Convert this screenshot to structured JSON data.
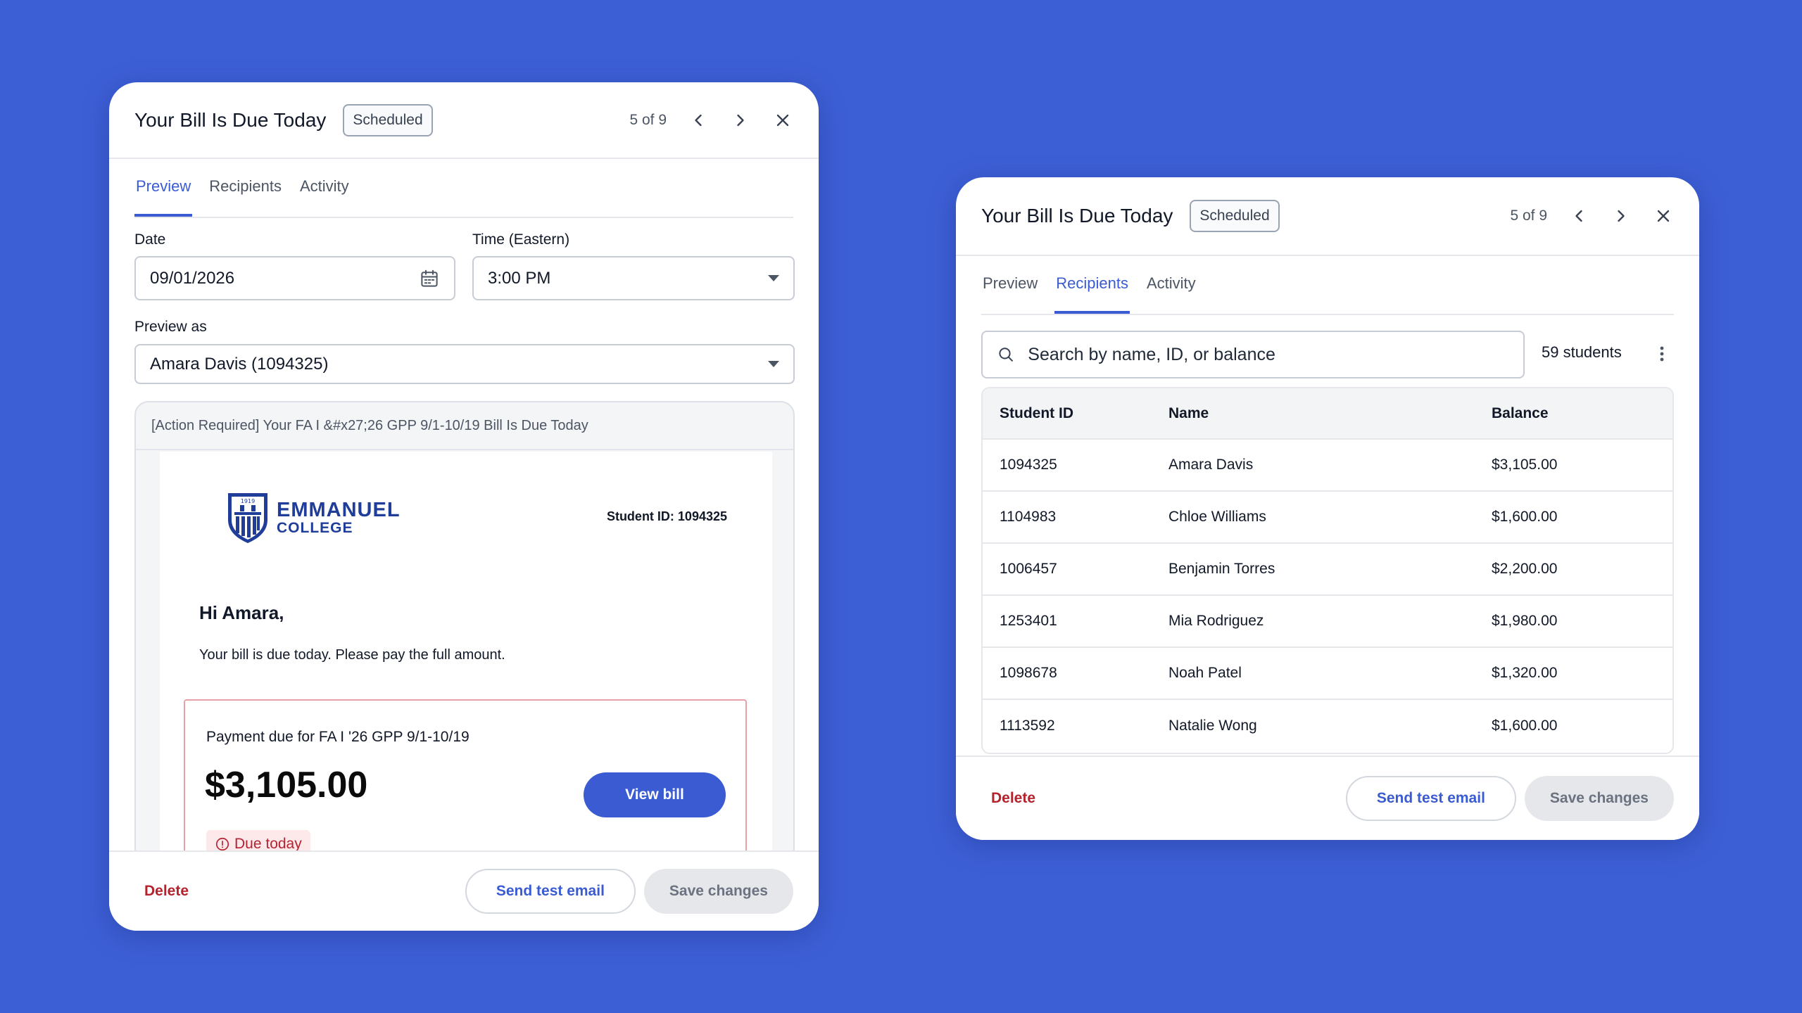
{
  "left_modal": {
    "title": "Your Bill Is Due Today",
    "status_badge": "Scheduled",
    "pager": "5 of 9",
    "tabs": [
      {
        "label": "Preview",
        "active": true
      },
      {
        "label": "Recipients",
        "active": false
      },
      {
        "label": "Activity",
        "active": false
      }
    ],
    "date_label": "Date",
    "date_value": "09/01/2026",
    "time_label": "Time (Eastern)",
    "time_value": "3:00 PM",
    "preview_as_label": "Preview as",
    "preview_as_value": "Amara Davis (1094325)",
    "email": {
      "subject": "[Action Required] Your FA I &#x27;26 GPP 9/1-10/19 Bill Is Due Today",
      "logo_line1": "EMMANUEL",
      "logo_line2": "COLLEGE",
      "logo_year": "1919",
      "student_id_line": "Student ID: 1094325",
      "greeting": "Hi Amara,",
      "message": "Your bill is due today. Please pay the full amount.",
      "payment_label": "Payment due for FA I '26 GPP 9/1-10/19",
      "amount": "$3,105.00",
      "view_bill_label": "View bill",
      "due_chip": "Due today"
    },
    "footer": {
      "delete_label": "Delete",
      "send_test_label": "Send test email",
      "save_label": "Save changes"
    }
  },
  "right_modal": {
    "title": "Your Bill Is Due Today",
    "status_badge": "Scheduled",
    "pager": "5 of 9",
    "tabs": [
      {
        "label": "Preview",
        "active": false
      },
      {
        "label": "Recipients",
        "active": true
      },
      {
        "label": "Activity",
        "active": false
      }
    ],
    "search_placeholder": "Search by name, ID, or balance",
    "count": "59 students",
    "columns": [
      "Student ID",
      "Name",
      "Balance"
    ],
    "rows": [
      [
        "1094325",
        "Amara Davis",
        "$3,105.00"
      ],
      [
        "1104983",
        "Chloe Williams",
        "$1,600.00"
      ],
      [
        "1006457",
        "Benjamin Torres",
        "$2,200.00"
      ],
      [
        "1253401",
        "Mia Rodriguez",
        "$1,980.00"
      ],
      [
        "1098678",
        "Noah Patel",
        "$1,320.00"
      ],
      [
        "1113592",
        "Natalie Wong",
        "$1,600.00"
      ]
    ],
    "footer": {
      "delete_label": "Delete",
      "send_test_label": "Send test email",
      "save_label": "Save changes"
    }
  },
  "colors": {
    "background": "#3d5fd6",
    "accent": "#3a5bd2",
    "danger": "#b4232d",
    "brand": "#1f3d99"
  }
}
